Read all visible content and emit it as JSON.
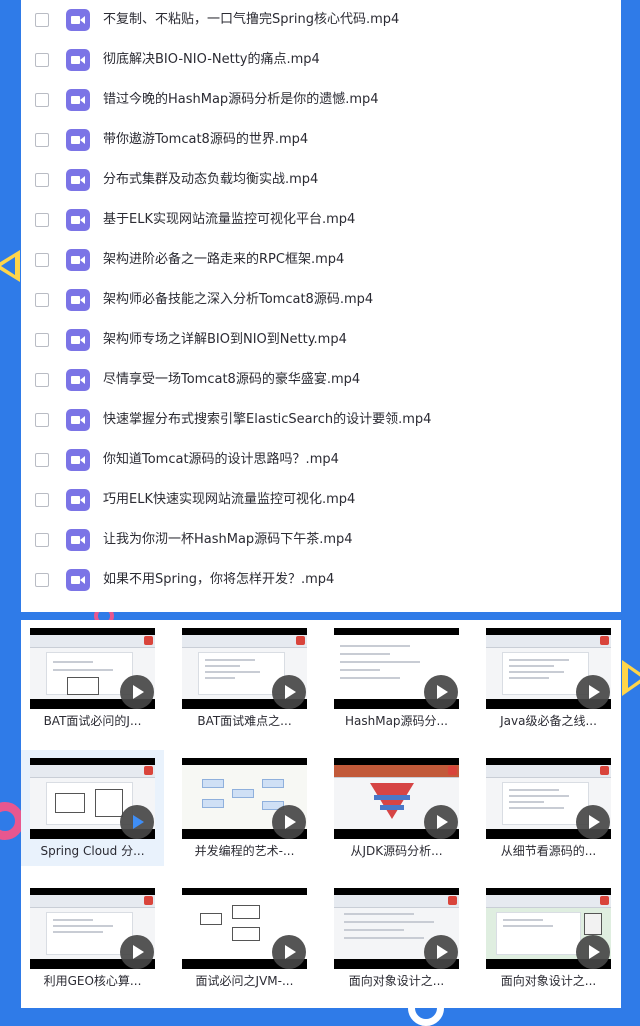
{
  "files": [
    "不复制、不粘贴，一口气撸完Spring核心代码.mp4",
    "彻底解决BIO-NIO-Netty的痛点.mp4",
    "错过今晚的HashMap源码分析是你的遗憾.mp4",
    "带你遨游Tomcat8源码的世界.mp4",
    "分布式集群及动态负载均衡实战.mp4",
    "基于ELK实现网站流量监控可视化平台.mp4",
    "架构进阶必备之一路走来的RPC框架.mp4",
    "架构师必备技能之深入分析Tomcat8源码.mp4",
    "架构师专场之详解BIO到NIO到Netty.mp4",
    "尽情享受一场Tomcat8源码的豪华盛宴.mp4",
    "快速掌握分布式搜索引擎ElasticSearch的设计要领.mp4",
    "你知道Tomcat源码的设计思路吗？.mp4",
    "巧用ELK快速实现网站流量监控可视化.mp4",
    "让我为你沏一杯HashMap源码下午茶.mp4",
    "如果不用Spring，你将怎样开发？.mp4"
  ],
  "thumbnails": [
    {
      "label": "BAT面试必问的J...",
      "selected": false
    },
    {
      "label": "BAT面试难点之...",
      "selected": false
    },
    {
      "label": "HashMap源码分...",
      "selected": false
    },
    {
      "label": "Java级必备之线...",
      "selected": false
    },
    {
      "label": "Spring Cloud 分...",
      "selected": true
    },
    {
      "label": "并发编程的艺术-...",
      "selected": false
    },
    {
      "label": "从JDK源码分析...",
      "selected": false
    },
    {
      "label": "从细节看源码的...",
      "selected": false
    },
    {
      "label": "利用GEO核心算...",
      "selected": false
    },
    {
      "label": "面试必问之JVM-...",
      "selected": false
    },
    {
      "label": "面向对象设计之...",
      "selected": false
    },
    {
      "label": "面向对象设计之...",
      "selected": false
    }
  ],
  "colors": {
    "background": "#2f7be8",
    "video_icon": "#7b74e6",
    "selected_tile": "#e9f2fc",
    "accent_yellow": "#ffd54a",
    "accent_pink": "#e8578f"
  },
  "icons": {
    "file_icon": "video-file-icon",
    "thumb_overlay": "play-icon"
  }
}
